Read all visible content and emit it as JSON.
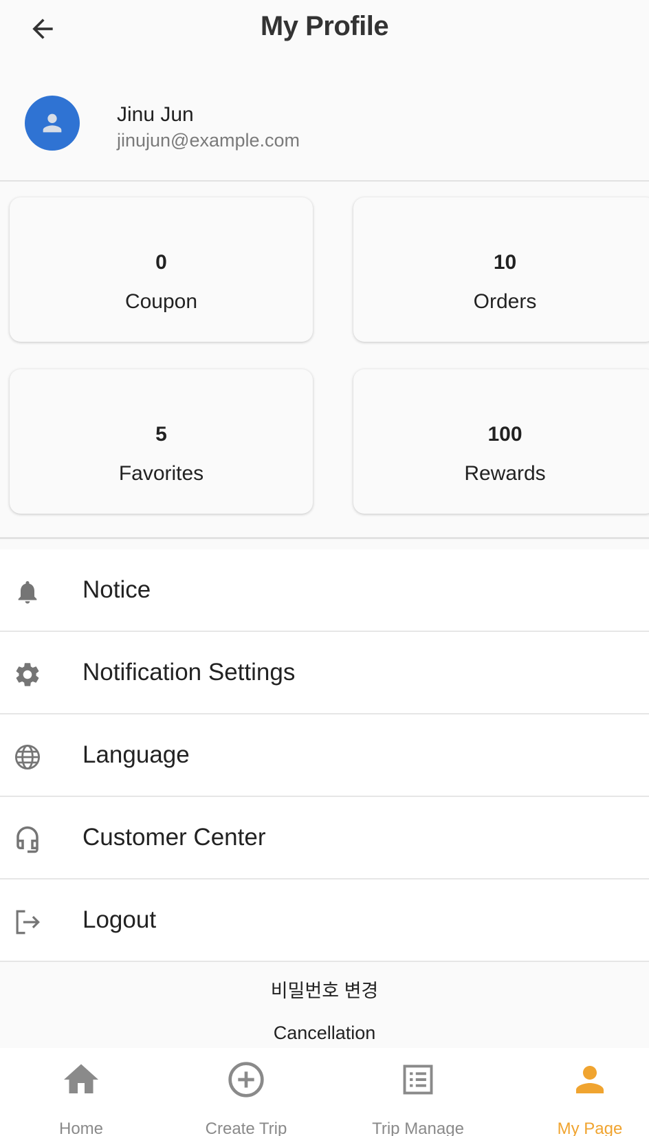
{
  "header": {
    "title": "My Profile",
    "back_icon": "arrow-left-icon"
  },
  "profile": {
    "name": "Jinu Jun",
    "email": "jinujun@example.com",
    "avatar_color": "#2f73d3"
  },
  "stats": [
    {
      "value": "0",
      "label": "Coupon"
    },
    {
      "value": "10",
      "label": "Orders"
    },
    {
      "value": "5",
      "label": "Favorites"
    },
    {
      "value": "100",
      "label": "Rewards"
    }
  ],
  "menu": [
    {
      "label": "Notice",
      "icon": "bell-icon"
    },
    {
      "label": "Notification Settings",
      "icon": "gear-icon"
    },
    {
      "label": "Language",
      "icon": "globe-icon"
    },
    {
      "label": "Customer Center",
      "icon": "headset-icon"
    },
    {
      "label": "Logout",
      "icon": "logout-icon"
    }
  ],
  "footer": {
    "change_password": "비밀번호 변경",
    "cancellation": "Cancellation"
  },
  "nav": {
    "active_color": "#f0a430",
    "items": [
      {
        "label": "Home",
        "icon": "home-icon"
      },
      {
        "label": "Create Trip",
        "icon": "add-circle-icon"
      },
      {
        "label": "Trip Manage",
        "icon": "list-icon"
      },
      {
        "label": "My Page",
        "icon": "person-icon",
        "active": true
      }
    ]
  }
}
